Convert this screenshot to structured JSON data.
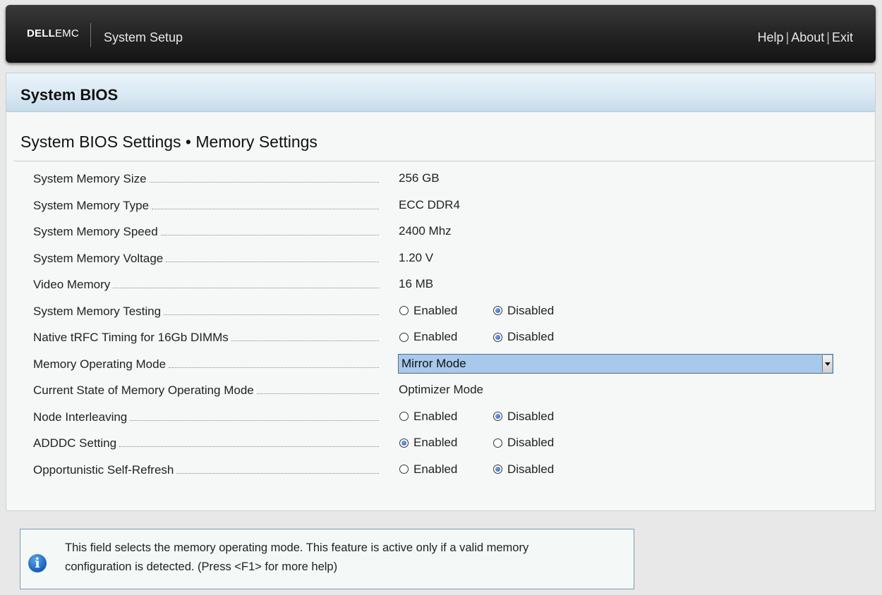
{
  "header": {
    "brand_dell": "DELL",
    "brand_emc": "EMC",
    "title": "System Setup",
    "links": [
      "Help",
      "About",
      "Exit"
    ],
    "separator": "|"
  },
  "panel": {
    "title": "System BIOS",
    "section_title": "System BIOS Settings • Memory Settings"
  },
  "settings": [
    {
      "label": "System Memory Size",
      "type": "text",
      "value": "256 GB"
    },
    {
      "label": "System Memory Type",
      "type": "text",
      "value": "ECC DDR4"
    },
    {
      "label": "System Memory Speed",
      "type": "text",
      "value": "2400 Mhz"
    },
    {
      "label": "System Memory Voltage",
      "type": "text",
      "value": "1.20 V"
    },
    {
      "label": "Video Memory",
      "type": "text",
      "value": "16 MB"
    },
    {
      "label": "System Memory Testing",
      "type": "radio",
      "options": [
        "Enabled",
        "Disabled"
      ],
      "selected": "Disabled"
    },
    {
      "label": "Native tRFC Timing for 16Gb DIMMs",
      "type": "radio",
      "options": [
        "Enabled",
        "Disabled"
      ],
      "selected": "Disabled"
    },
    {
      "label": "Memory Operating Mode",
      "type": "select",
      "value": "Mirror Mode"
    },
    {
      "label": "Current State of Memory Operating Mode",
      "type": "text",
      "value": "Optimizer Mode"
    },
    {
      "label": "Node Interleaving",
      "type": "radio",
      "options": [
        "Enabled",
        "Disabled"
      ],
      "selected": "Disabled"
    },
    {
      "label": "ADDDC Setting",
      "type": "radio",
      "options": [
        "Enabled",
        "Disabled"
      ],
      "selected": "Enabled"
    },
    {
      "label": "Opportunistic Self-Refresh",
      "type": "radio",
      "options": [
        "Enabled",
        "Disabled"
      ],
      "selected": "Disabled"
    }
  ],
  "help": {
    "icon": "info-icon",
    "text_line1": "This field selects the memory operating mode. This feature is active only if a valid memory",
    "text_line2": "configuration is detected. (Press <F1> for more help)"
  },
  "colors": {
    "select_bg": "#a8c8ec",
    "radio_selected": "#1f5cc2",
    "header_bar": "#1e1e1e"
  }
}
